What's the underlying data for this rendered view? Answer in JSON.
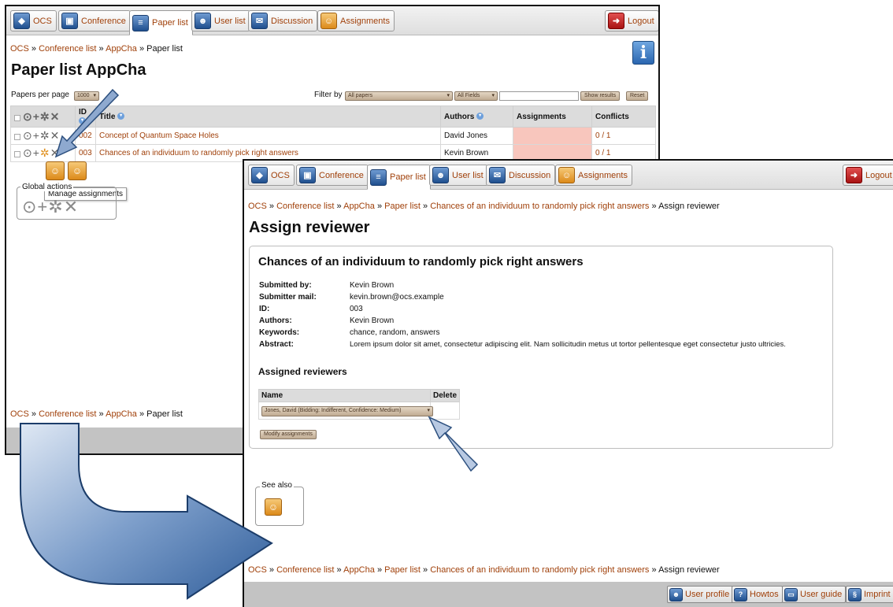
{
  "nav": {
    "tabs": [
      {
        "label": "OCS",
        "icon": "ocs-logo-icon"
      },
      {
        "label": "Conference",
        "icon": "conference-icon"
      },
      {
        "label": "Paper list",
        "icon": "paper-list-icon"
      },
      {
        "label": "User list",
        "icon": "user-list-icon"
      },
      {
        "label": "Discussion",
        "icon": "discussion-icon"
      },
      {
        "label": "Assignments",
        "icon": "assignments-icon"
      }
    ],
    "logout": "Logout"
  },
  "paper_list": {
    "breadcrumb": [
      "OCS",
      "Conference list",
      "AppCha",
      "Paper list"
    ],
    "sep": "»",
    "title": "Paper list AppCha",
    "per_page_label": "Papers per page",
    "per_page_value": "1000",
    "filter_label": "Filter by",
    "filter_value": "All papers",
    "filter_field": "All Fields",
    "filter_text": "",
    "show_results": "Show results",
    "reset": "Reset",
    "columns": [
      "ID",
      "Title",
      "Authors",
      "Assignments",
      "Conflicts"
    ],
    "rows": [
      {
        "id": "002",
        "title": "Concept of Quantum Space Holes",
        "authors": "David Jones",
        "conflicts": "0 / 1"
      },
      {
        "id": "003",
        "title": "Chances of an individuum to randomly pick right answers",
        "authors": "Kevin Brown",
        "conflicts": "0 / 1"
      }
    ],
    "tooltip": "Manage assignments",
    "global_actions": "Global actions",
    "footer_breadcrumb": [
      "OCS",
      "Conference list",
      "AppCha",
      "Paper list"
    ]
  },
  "assign": {
    "breadcrumb": [
      "OCS",
      "Conference list",
      "AppCha",
      "Paper list",
      "Chances of an individuum to randomly pick right answers"
    ],
    "breadcrumb_current": "Assign reviewer",
    "sep": "»",
    "title": "Assign reviewer",
    "paper_title": "Chances of an individuum to randomly pick right answers",
    "fields": [
      {
        "k": "Submitted by:",
        "v": "Kevin Brown"
      },
      {
        "k": "Submitter mail:",
        "v": "kevin.brown@ocs.example"
      },
      {
        "k": "ID:",
        "v": "003"
      },
      {
        "k": "Authors:",
        "v": "Kevin Brown"
      },
      {
        "k": "Keywords:",
        "v": "chance, random, answers"
      },
      {
        "k": "Abstract:",
        "v": "Lorem ipsum dolor sit amet, consectetur adipiscing elit. Nam sollicitudin metus ut tortor pellentesque eget consectetur justo ultricies."
      }
    ],
    "assigned_heading": "Assigned reviewers",
    "col_name": "Name",
    "col_delete": "Delete",
    "reviewer_select": "Jones, David (Bidding: Indifferent, Confidence: Medium)",
    "modify_button": "Modify assignments",
    "see_also": "See also",
    "footer_breadcrumb": [
      "OCS",
      "Conference list",
      "AppCha",
      "Paper list",
      "Chances of an individuum to randomly pick right answers"
    ],
    "footer_current": "Assign reviewer",
    "bottom_buttons": [
      "User profile",
      "Howtos",
      "User guide",
      "Imprint"
    ]
  },
  "colors": {
    "link": "#a0400a",
    "tab_icon_blue": "#2a5a9a",
    "accent_orange": "#e0901f",
    "arrow_fill": "#7e9fcb"
  }
}
